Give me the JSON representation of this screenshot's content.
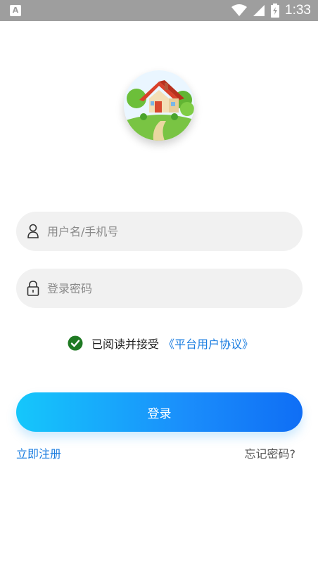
{
  "status_bar": {
    "notification_icon_label": "A",
    "time": "1:33",
    "icons": [
      "wifi-icon",
      "signal-icon",
      "battery-charging-icon"
    ]
  },
  "logo": {
    "icon": "house-icon"
  },
  "username_field": {
    "icon": "user-icon",
    "placeholder": "用户名/手机号"
  },
  "password_field": {
    "icon": "lock-icon",
    "placeholder": "登录密码"
  },
  "agreement": {
    "checked": true,
    "text": "已阅读并接受",
    "link": "《平台用户协议》"
  },
  "login_button": {
    "label": "登录"
  },
  "register_link": "立即注册",
  "forgot_link": "忘记密码?",
  "colors": {
    "accent": "#1a7de0",
    "button_start": "#15c7fb",
    "button_end": "#0f6ef5",
    "check": "#1f7a23",
    "status_bar": "#9e9e9e"
  }
}
